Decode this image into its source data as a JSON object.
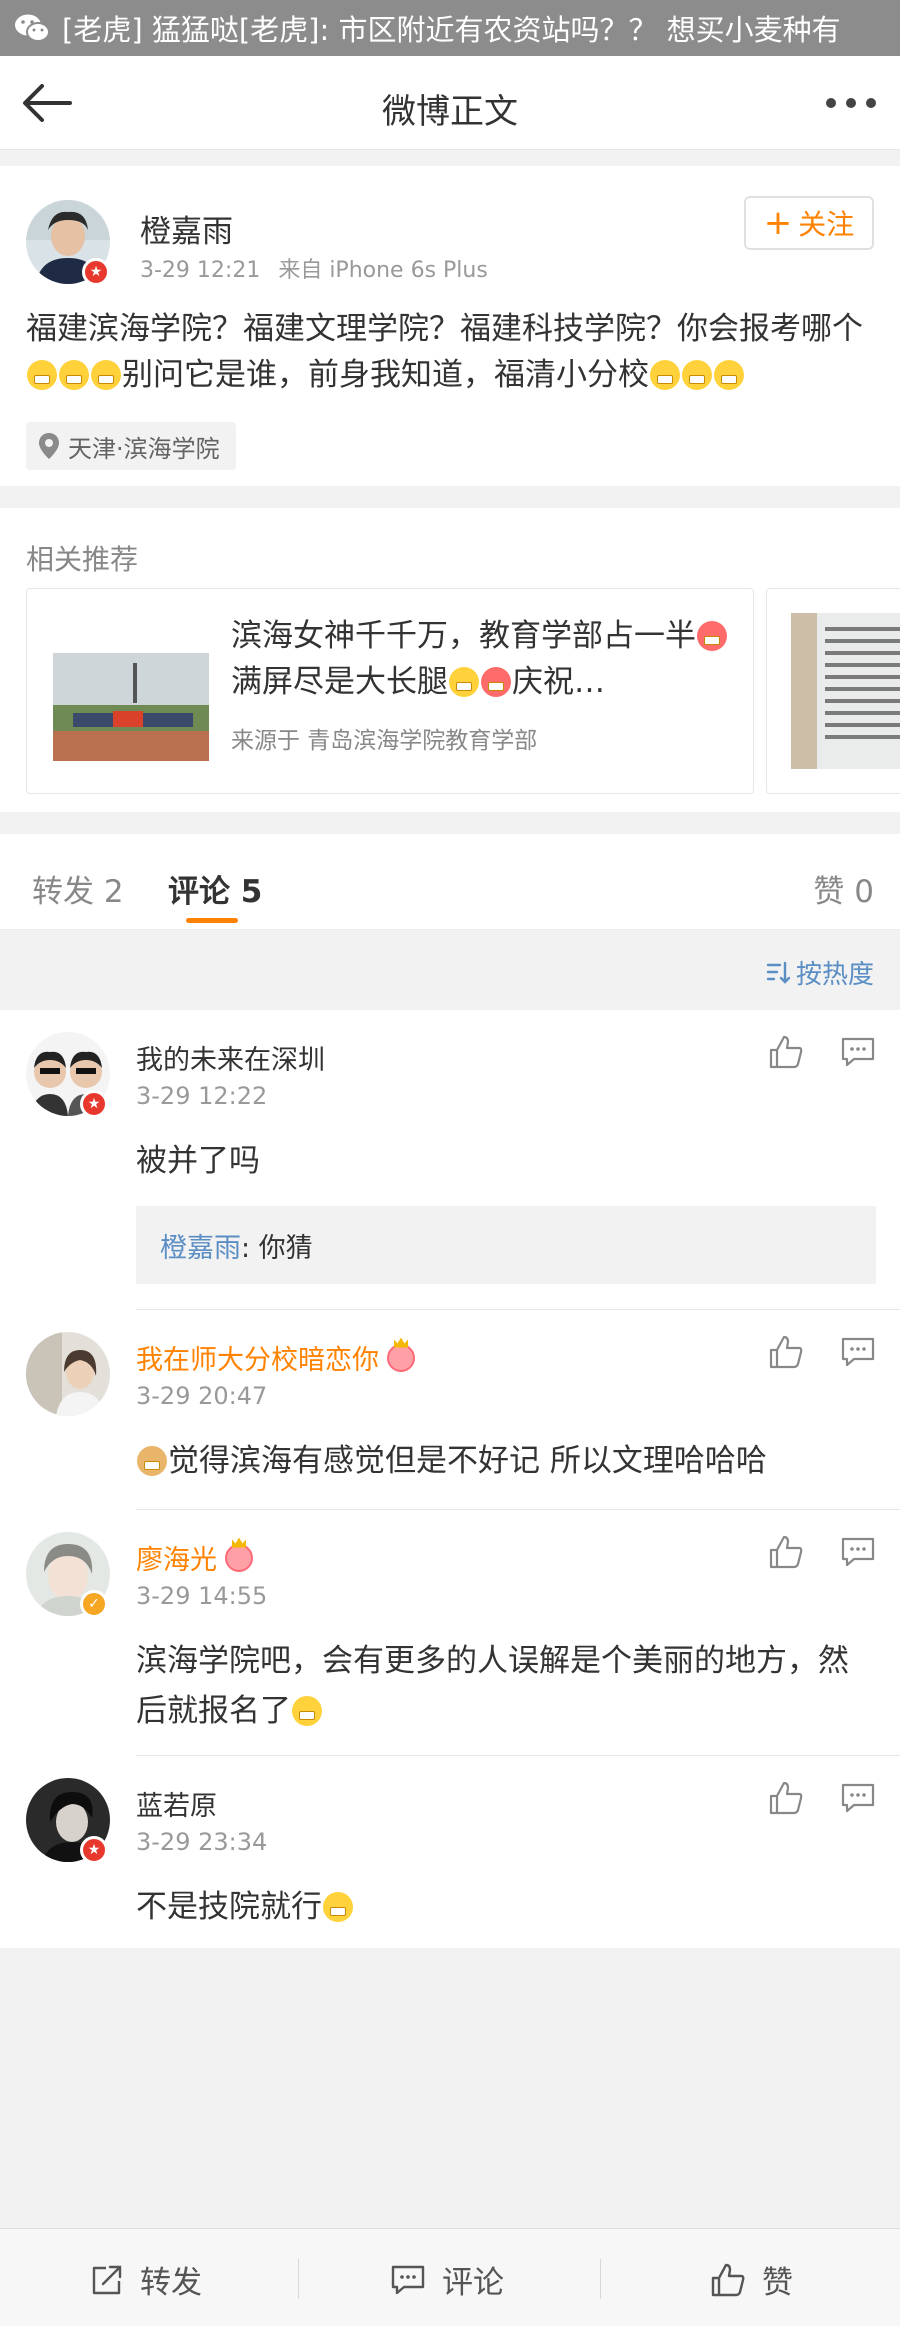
{
  "notification": {
    "app_icon": "wechat-icon",
    "text": "[老虎] 猛猛哒[老虎]: 市区附近有农资站吗？？ 想买小麦种有"
  },
  "navbar": {
    "back_icon": "back-arrow-icon",
    "title": "微博正文",
    "more_icon": "more-dots-icon"
  },
  "post": {
    "author": "橙嘉雨",
    "time": "3-29 12:21",
    "source": "来自 iPhone 6s Plus",
    "follow_label": "关注",
    "content_1": "福建滨海学院？福建文理学院？福建科技学院？你会报考哪个",
    "content_2": "别问它是谁，前身我知道，福清小分校",
    "location": "天津·滨海学院"
  },
  "related": {
    "header": "相关推荐",
    "card_title_1": "滨海女神千千万，教育学部占一半",
    "card_title_2": "满屏尽是大长腿",
    "card_title_3": "庆祝…",
    "card_source": "来源于  青岛滨海学院教育学部"
  },
  "tabs": {
    "repost": "转发 2",
    "comment": "评论 5",
    "like": "赞 0",
    "sort": "按热度"
  },
  "comments": [
    {
      "name": "我的未来在深圳",
      "time": "3-29 12:22",
      "text": "被并了吗",
      "reply_name": "橙嘉雨",
      "reply_text": ": 你猜"
    },
    {
      "name": "我在师大分校暗恋你",
      "time": "3-29 20:47",
      "text": "觉得滨海有感觉但是不好记 所以文理哈哈哈"
    },
    {
      "name": "廖海光",
      "time": "3-29 14:55",
      "text": "滨海学院吧，会有更多的人误解是个美丽的地方，然后就报名了"
    },
    {
      "name": "蓝若原",
      "time": "3-29 23:34",
      "text": "不是技院就行"
    }
  ],
  "bottombar": {
    "repost": "转发",
    "comment": "评论",
    "like": "赞"
  },
  "colors": {
    "accent": "#ff8200",
    "link": "#5b8ec4",
    "badge_red": "#e8372d",
    "badge_gold": "#f5a623"
  }
}
